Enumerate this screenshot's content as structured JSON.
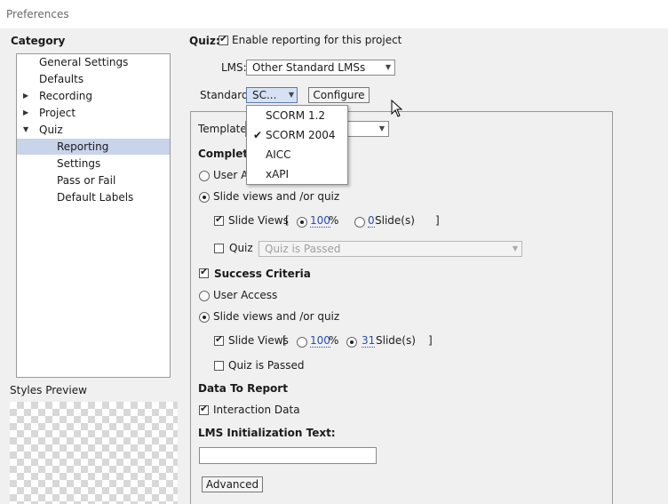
{
  "window": {
    "title": "Preferences"
  },
  "category": {
    "label": "Category",
    "items": [
      {
        "label": "General Settings",
        "expander": ""
      },
      {
        "label": "Defaults",
        "expander": ""
      },
      {
        "label": "Recording",
        "expander": "▶"
      },
      {
        "label": "Project",
        "expander": "▶"
      },
      {
        "label": "Quiz",
        "expander": "▼"
      },
      {
        "label": "Reporting",
        "expander": ""
      },
      {
        "label": "Settings",
        "expander": ""
      },
      {
        "label": "Pass or Fail",
        "expander": ""
      },
      {
        "label": "Default Labels",
        "expander": ""
      }
    ],
    "selected": "Reporting"
  },
  "styles_preview": {
    "label": "Styles Preview"
  },
  "quiz": {
    "label": "Quiz:",
    "enable_reporting": {
      "label": "Enable reporting for this project",
      "checked": true
    }
  },
  "lms": {
    "label": "LMS:",
    "value": "Other Standard LMSs"
  },
  "standard": {
    "label": "Standard:",
    "value": "SC...",
    "configure_label": "Configure",
    "options": [
      {
        "label": "SCORM 1.2",
        "checked": false
      },
      {
        "label": "SCORM 2004",
        "checked": true
      },
      {
        "label": "AICC",
        "checked": false
      },
      {
        "label": "xAPI",
        "checked": false
      }
    ]
  },
  "template": {
    "label": "Template:",
    "value": ""
  },
  "completion": {
    "label": "Completio",
    "user_access": "User Ac",
    "slide_views_or_quiz": "Slide views and /or quiz",
    "slide_views": {
      "label": "Slide Views",
      "open": "[",
      "percent_value": "100",
      "percent_unit": "%",
      "slides_value": "0",
      "slides_unit": "Slide(s)",
      "close": "]"
    },
    "quiz": {
      "label": "Quiz",
      "dropdown": "Quiz is Passed"
    }
  },
  "success": {
    "label": "Success Criteria",
    "user_access": "User Access",
    "slide_views_or_quiz": "Slide views and /or quiz",
    "slide_views": {
      "label": "Slide Views",
      "open": "[",
      "percent_value": "100",
      "percent_unit": "%",
      "slides_value": "31",
      "slides_unit": "Slide(s)",
      "close": "]"
    },
    "quiz_passed": "Quiz is Passed"
  },
  "data_to_report": {
    "label": "Data To Report",
    "interaction_data": "Interaction Data"
  },
  "lms_init": {
    "label": "LMS Initialization Text:",
    "value": ""
  },
  "advanced": {
    "label": "Advanced"
  },
  "icons": {
    "check": "✔",
    "combo_arrow": "▼",
    "cursor": "pointer-icon"
  }
}
